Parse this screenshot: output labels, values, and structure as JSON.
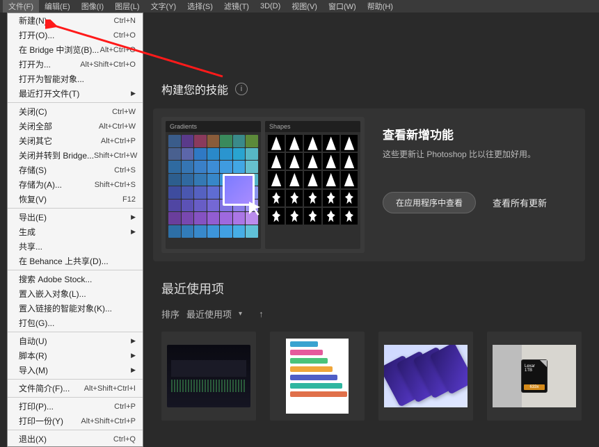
{
  "menubar": {
    "items": [
      {
        "label": "文件(F)"
      },
      {
        "label": "编辑(E)"
      },
      {
        "label": "图像(I)"
      },
      {
        "label": "图层(L)"
      },
      {
        "label": "文字(Y)"
      },
      {
        "label": "选择(S)"
      },
      {
        "label": "滤镜(T)"
      },
      {
        "label": "3D(D)"
      },
      {
        "label": "视图(V)"
      },
      {
        "label": "窗口(W)"
      },
      {
        "label": "帮助(H)"
      }
    ]
  },
  "file_menu": {
    "groups": [
      [
        {
          "label": "新建(N)...",
          "shortcut": "Ctrl+N"
        },
        {
          "label": "打开(O)...",
          "shortcut": "Ctrl+O"
        },
        {
          "label": "在 Bridge 中浏览(B)...",
          "shortcut": "Alt+Ctrl+O"
        },
        {
          "label": "打开为...",
          "shortcut": "Alt+Shift+Ctrl+O"
        },
        {
          "label": "打开为智能对象..."
        },
        {
          "label": "最近打开文件(T)",
          "submenu": true
        }
      ],
      [
        {
          "label": "关闭(C)",
          "shortcut": "Ctrl+W"
        },
        {
          "label": "关闭全部",
          "shortcut": "Alt+Ctrl+W"
        },
        {
          "label": "关闭其它",
          "shortcut": "Alt+Ctrl+P"
        },
        {
          "label": "关闭并转到 Bridge...",
          "shortcut": "Shift+Ctrl+W"
        },
        {
          "label": "存储(S)",
          "shortcut": "Ctrl+S"
        },
        {
          "label": "存储为(A)...",
          "shortcut": "Shift+Ctrl+S"
        },
        {
          "label": "恢复(V)",
          "shortcut": "F12"
        }
      ],
      [
        {
          "label": "导出(E)",
          "submenu": true
        },
        {
          "label": "生成",
          "submenu": true
        },
        {
          "label": "共享..."
        },
        {
          "label": "在 Behance 上共享(D)..."
        }
      ],
      [
        {
          "label": "搜索 Adobe Stock..."
        },
        {
          "label": "置入嵌入对象(L)..."
        },
        {
          "label": "置入链接的智能对象(K)..."
        },
        {
          "label": "打包(G)..."
        }
      ],
      [
        {
          "label": "自动(U)",
          "submenu": true
        },
        {
          "label": "脚本(R)",
          "submenu": true
        },
        {
          "label": "导入(M)",
          "submenu": true
        }
      ],
      [
        {
          "label": "文件简介(F)...",
          "shortcut": "Alt+Shift+Ctrl+I"
        }
      ],
      [
        {
          "label": "打印(P)...",
          "shortcut": "Ctrl+P"
        },
        {
          "label": "打印一份(Y)",
          "shortcut": "Alt+Shift+Ctrl+P"
        }
      ],
      [
        {
          "label": "退出(X)",
          "shortcut": "Ctrl+Q"
        }
      ]
    ]
  },
  "skills": {
    "section_title": "构建您的技能"
  },
  "feature": {
    "panel_gradients": "Gradients",
    "panel_shapes": "Shapes",
    "title": "查看新增功能",
    "desc": "这些更新让 Photoshop 比以往更加好用。",
    "btn_view_in_app": "在应用程序中查看",
    "link_all_updates": "查看所有更新"
  },
  "recent": {
    "title": "最近使用项",
    "sort_label": "排序",
    "sort_selected": "最近使用项"
  },
  "gradient_colors": [
    "#3a5c8a",
    "#5a3a8a",
    "#8a3a5c",
    "#8a5c3a",
    "#3a8a5c",
    "#3a8a8a",
    "#5c8a3a",
    "#49608f",
    "#5c66aa",
    "#2f79c4",
    "#2a89c9",
    "#2a95cf",
    "#29a4d0",
    "#57b7c5",
    "#2f6aa0",
    "#3575b3",
    "#3a80c8",
    "#3d8dd6",
    "#3f9be0",
    "#42a7e4",
    "#66c0cd",
    "#2d5e8e",
    "#3069a0",
    "#3479b4",
    "#3787c9",
    "#3a95d8",
    "#3ea2de",
    "#55b6ca",
    "#3e4c9e",
    "#4a57b0",
    "#5561c1",
    "#5f6cd3",
    "#6877e2",
    "#7383ea",
    "#8a95ee",
    "#5046a3",
    "#5c52b6",
    "#685dc6",
    "#7468d5",
    "#8073e2",
    "#8c7fea",
    "#9f94f0",
    "#6a3e9c",
    "#7848b0",
    "#8552c2",
    "#925dd2",
    "#9e69de",
    "#ab76e6",
    "#bb8ced",
    "#2d6fa6",
    "#327cb9",
    "#3889cb",
    "#3d95da",
    "#41a0e2",
    "#47aee6",
    "#60c1d8"
  ],
  "infographic_colors": [
    "#3aa3d0",
    "#e55a9c",
    "#4ac37a",
    "#f0a63a",
    "#4f5ec6",
    "#2fb6a0",
    "#e0704a"
  ]
}
